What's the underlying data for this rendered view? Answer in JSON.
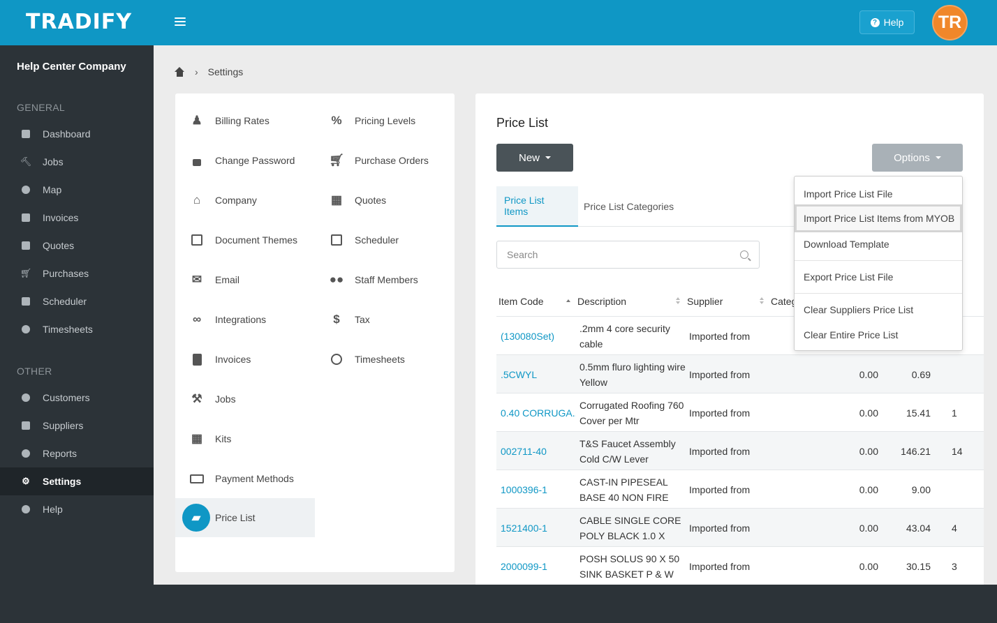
{
  "header": {
    "logo": "TRADIFY",
    "help_label": "Help",
    "avatar_initials": "TR",
    "colors": {
      "brand": "#0f97c5",
      "avatar": "#f0872a"
    }
  },
  "sidebar": {
    "company": "Help Center Company",
    "general_label": "GENERAL",
    "other_label": "OTHER",
    "general": [
      {
        "label": "Dashboard",
        "icon": "dashboard-icon"
      },
      {
        "label": "Jobs",
        "icon": "hammer-icon"
      },
      {
        "label": "Map",
        "icon": "map-pin-icon"
      },
      {
        "label": "Invoices",
        "icon": "invoice-icon"
      },
      {
        "label": "Quotes",
        "icon": "calculator-icon"
      },
      {
        "label": "Purchases",
        "icon": "cart-icon"
      },
      {
        "label": "Scheduler",
        "icon": "calendar-icon"
      },
      {
        "label": "Timesheets",
        "icon": "clock-icon"
      }
    ],
    "other": [
      {
        "label": "Customers",
        "icon": "users-icon"
      },
      {
        "label": "Suppliers",
        "icon": "truck-icon"
      },
      {
        "label": "Reports",
        "icon": "pie-chart-icon"
      },
      {
        "label": "Settings",
        "icon": "gear-icon",
        "active": true
      },
      {
        "label": "Help",
        "icon": "question-icon"
      }
    ]
  },
  "breadcrumb": {
    "current": "Settings"
  },
  "settings": {
    "col1": [
      {
        "label": "Billing Rates",
        "icon": "person-icon"
      },
      {
        "label": "Change Password",
        "icon": "unlock-icon"
      },
      {
        "label": "Company",
        "icon": "home-icon"
      },
      {
        "label": "Document Themes",
        "icon": "copy-icon"
      },
      {
        "label": "Email",
        "icon": "envelope-icon"
      },
      {
        "label": "Integrations",
        "icon": "link-icon"
      },
      {
        "label": "Invoices",
        "icon": "file-icon"
      },
      {
        "label": "Jobs",
        "icon": "hammer-icon"
      },
      {
        "label": "Kits",
        "icon": "cubes-icon"
      },
      {
        "label": "Payment Methods",
        "icon": "money-icon"
      },
      {
        "label": "Price List",
        "icon": "book-icon",
        "active": true
      }
    ],
    "col2": [
      {
        "label": "Pricing Levels",
        "icon": "percent-icon"
      },
      {
        "label": "Purchase Orders",
        "icon": "cart-icon"
      },
      {
        "label": "Quotes",
        "icon": "calculator-icon"
      },
      {
        "label": "Scheduler",
        "icon": "calendar-icon"
      },
      {
        "label": "Staff Members",
        "icon": "group-icon"
      },
      {
        "label": "Tax",
        "icon": "dollar-icon"
      },
      {
        "label": "Timesheets",
        "icon": "clock-icon"
      }
    ]
  },
  "price_list": {
    "title": "Price List",
    "new_label": "New",
    "options_label": "Options",
    "tabs": [
      {
        "label": "Price List Items",
        "active": true
      },
      {
        "label": "Price List Categories",
        "active": false
      }
    ],
    "search_placeholder": "Search",
    "columns": [
      "Item Code",
      "Description",
      "Supplier",
      "Categ"
    ],
    "rows": [
      {
        "code": "(130080Set)",
        "desc": ".2mm 4 core security cable",
        "supplier": "Imported from",
        "v1": "",
        "v2": "",
        "v3": ""
      },
      {
        "code": ".5CWYL",
        "desc": "0.5mm fluro lighting wire Yellow",
        "supplier": "Imported from",
        "v1": "0.00",
        "v2": "0.69",
        "v3": ""
      },
      {
        "code": "0.40 CORRUGA...",
        "desc": "Corrugated Roofing 760 Cover per Mtr",
        "supplier": "Imported from",
        "v1": "0.00",
        "v2": "15.41",
        "v3": "1"
      },
      {
        "code": "002711-40",
        "desc": "T&S Faucet Assembly Cold C/W Lever",
        "supplier": "Imported from",
        "v1": "0.00",
        "v2": "146.21",
        "v3": "14"
      },
      {
        "code": "1000396-1",
        "desc": "CAST-IN PIPESEAL BASE 40 NON FIRE",
        "supplier": "Imported from",
        "v1": "0.00",
        "v2": "9.00",
        "v3": ""
      },
      {
        "code": "1521400-1",
        "desc": "CABLE SINGLE CORE POLY BLACK 1.0 X",
        "supplier": "Imported from",
        "v1": "0.00",
        "v2": "43.04",
        "v3": "4"
      },
      {
        "code": "2000099-1",
        "desc": "POSH SOLUS 90 X 50 SINK BASKET P & W",
        "supplier": "Imported from",
        "v1": "0.00",
        "v2": "30.15",
        "v3": "3"
      }
    ]
  },
  "options_menu": [
    {
      "label": "Import Price List File"
    },
    {
      "label": "Import Price List Items from MYOB",
      "highlighted": true
    },
    {
      "label": "Download Template"
    },
    {
      "label": "Export Price List File"
    },
    {
      "label": "Clear Suppliers Price List"
    },
    {
      "label": "Clear Entire Price List"
    }
  ]
}
